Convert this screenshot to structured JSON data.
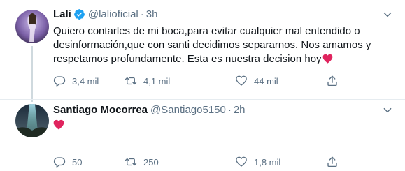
{
  "tweets": [
    {
      "name": "Lali",
      "handle": "@lalioficial",
      "separator": "·",
      "time": "3h",
      "text_lines": [
        "Quiero contarles de mi boca,para evitar cualquier mal entendido o",
        "desinformación,que con santi decidimos separarnos. Nos amamos y",
        "respetamos profundamente. Esta es nuestra decision hoy"
      ],
      "replies": "3,4 mil",
      "retweets": "4,1 mil",
      "likes": "44 mil"
    },
    {
      "name": "Santiago Mocorrea",
      "handle": "@Santiago5150",
      "separator": "·",
      "time": "2h",
      "replies": "50",
      "retweets": "250",
      "likes": "1,8 mil"
    }
  ],
  "colors": {
    "verified": "#1da1f2",
    "heart": "#e0245e",
    "muted": "#5b7083"
  }
}
